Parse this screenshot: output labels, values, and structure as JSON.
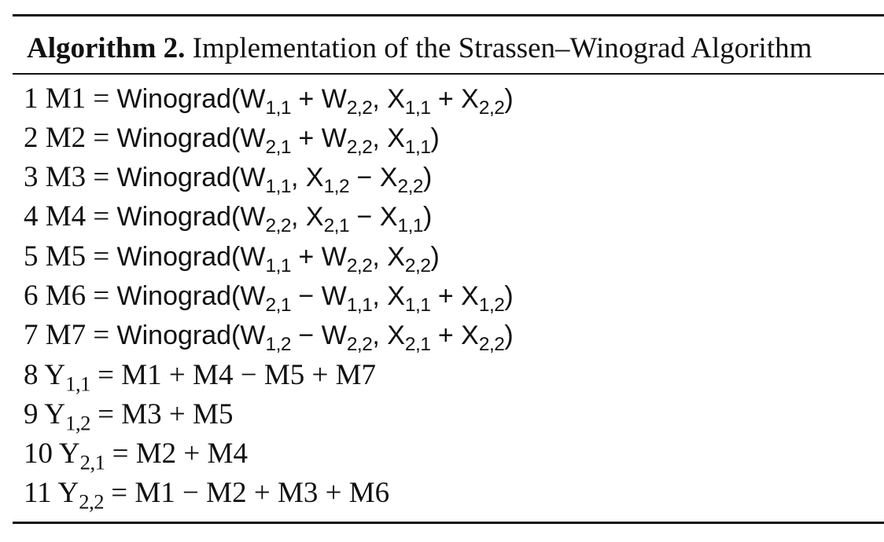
{
  "caption": {
    "label": "Algorithm 2.",
    "text": "Implementation of the Strassen–Winograd Algorithm"
  },
  "lines": [
    {
      "num": "1",
      "lhs": "M1",
      "eq": " = ",
      "rhs": "Winograd(W<sub>1,1</sub> + W<sub>2,2</sub>, X<sub>1,1</sub> + X<sub>2,2</sub>)",
      "sans": true
    },
    {
      "num": "2",
      "lhs": "M2",
      "eq": " = ",
      "rhs": "Winograd(W<sub>2,1</sub> + W<sub>2,2</sub>, X<sub>1,1</sub>)",
      "sans": true
    },
    {
      "num": "3",
      "lhs": "M3",
      "eq": " = ",
      "rhs": "Winograd(W<sub>1,1</sub>, X<sub>1,2</sub> − X<sub>2,2</sub>)",
      "sans": true
    },
    {
      "num": "4",
      "lhs": "M4",
      "eq": " = ",
      "rhs": "Winograd(W<sub>2,2</sub>, X<sub>2,1</sub> − X<sub>1,1</sub>)",
      "sans": true
    },
    {
      "num": "5",
      "lhs": "M5",
      "eq": " = ",
      "rhs": "Winograd(W<sub>1,1</sub> + W<sub>2,2</sub>, X<sub>2,2</sub>)",
      "sans": true
    },
    {
      "num": "6",
      "lhs": "M6",
      "eq": " = ",
      "rhs": "Winograd(W<sub>2,1</sub> − W<sub>1,1</sub>, X<sub>1,1</sub> + X<sub>1,2</sub>)",
      "sans": true
    },
    {
      "num": "7",
      "lhs": "M7",
      "eq": " = ",
      "rhs": "Winograd(W<sub>1,2</sub> − W<sub>2,2</sub>, X<sub>2,1</sub> + X<sub>2,2</sub>)",
      "sans": true
    },
    {
      "num": "8",
      "lhs": "Y<sub>1,1</sub>",
      "eq": " = ",
      "rhs": "M1 + M4 − M5 + M7",
      "sans": false
    },
    {
      "num": "9",
      "lhs": "Y<sub>1,2</sub>",
      "eq": " = ",
      "rhs": "M3 + M5",
      "sans": false
    },
    {
      "num": "10",
      "lhs": "Y<sub>2,1</sub>",
      "eq": " = ",
      "rhs": "M2 + M4",
      "sans": false
    },
    {
      "num": "11",
      "lhs": "Y<sub>2,2</sub>",
      "eq": " = ",
      "rhs": "M1 − M2 + M3 + M6",
      "sans": false
    }
  ]
}
